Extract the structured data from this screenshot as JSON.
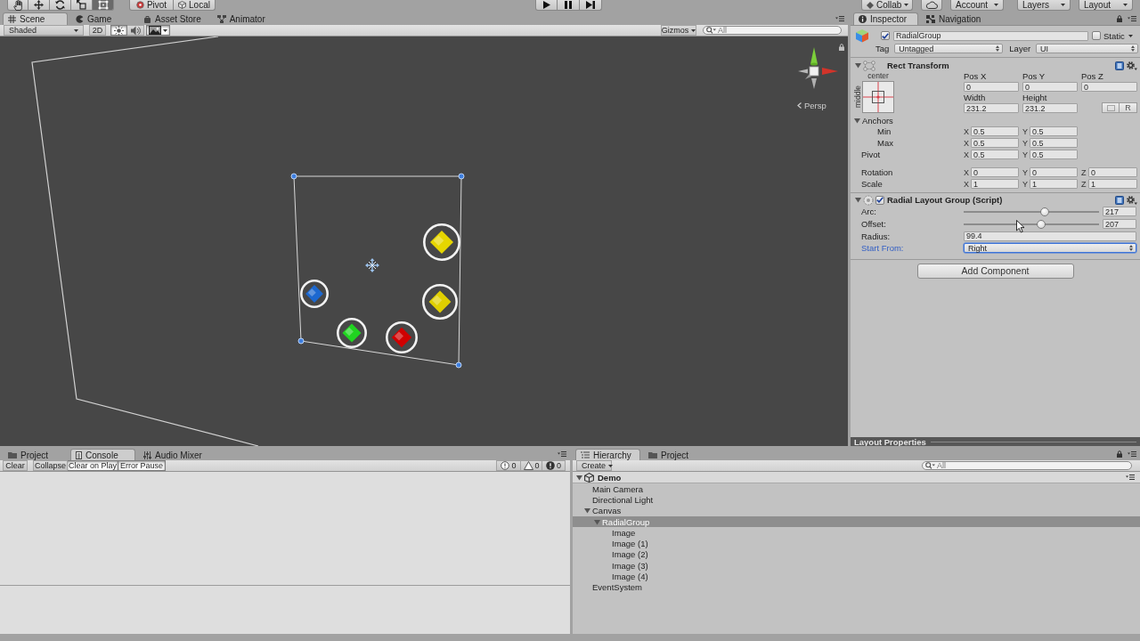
{
  "toolbar": {
    "tools": [
      {
        "kind": "hand",
        "selected": false
      },
      {
        "kind": "move",
        "selected": false
      },
      {
        "kind": "rotate",
        "selected": false
      },
      {
        "kind": "scale",
        "selected": false
      },
      {
        "kind": "rect",
        "selected": true
      }
    ],
    "handle_modes": [
      {
        "kind": "pivot",
        "label": "Pivot"
      },
      {
        "kind": "local",
        "label": "Local"
      }
    ],
    "playback": [
      {
        "kind": "play"
      },
      {
        "kind": "pause"
      },
      {
        "kind": "step"
      }
    ],
    "menus": [
      {
        "kind": "collab",
        "label": "Collab"
      },
      {
        "kind": "cloud"
      },
      {
        "kind": "account",
        "label": "Account"
      },
      {
        "kind": "layers",
        "label": "Layers"
      },
      {
        "kind": "layout",
        "label": "Layout"
      }
    ]
  },
  "scene": {
    "tabs": [
      {
        "kind": "scene",
        "label": "Scene",
        "selected": true
      },
      {
        "kind": "game",
        "label": "Game",
        "selected": false
      },
      {
        "kind": "asset_store",
        "label": "Asset Store",
        "selected": false
      },
      {
        "kind": "animator",
        "label": "Animator",
        "selected": false
      }
    ],
    "toolbar": {
      "draw_mode": "Shaded",
      "toggles": [
        {
          "kind": "flat",
          "label": "2D",
          "on": false
        },
        {
          "kind": "lighting",
          "on": true
        },
        {
          "kind": "audio",
          "on": false
        },
        {
          "kind": "effects",
          "on": true
        }
      ],
      "gizmos": "Gizmos",
      "search": {
        "placeholder": "All"
      }
    },
    "images": [
      {
        "color": "#e6d600"
      },
      {
        "color": "#1c68d0"
      },
      {
        "color": "#e0cf00"
      },
      {
        "color": "#20d420"
      },
      {
        "color": "#d00000"
      }
    ],
    "view_label": "Persp"
  },
  "inspector": {
    "tabs": [
      {
        "kind": "inspector",
        "label": "Inspector",
        "selected": true
      },
      {
        "kind": "navigation",
        "label": "Navigation",
        "selected": false
      }
    ],
    "object": {
      "active": true,
      "name": "RadialGroup",
      "static": false,
      "static_label": "Static",
      "tag_label": "Tag",
      "tag": "Untagged",
      "layer_label": "Layer",
      "layer": "UI"
    },
    "rect_transform": {
      "title": "Rect Transform",
      "expanded": true,
      "anchor_preset": {
        "horizontal": "center",
        "vertical": "middle"
      },
      "position": [
        {
          "label": "Pos X",
          "value": "0"
        },
        {
          "label": "Pos Y",
          "value": "0"
        },
        {
          "label": "Pos Z",
          "value": "0"
        }
      ],
      "size": [
        {
          "label": "Width",
          "value": "231.2"
        },
        {
          "label": "Height",
          "value": "231.2"
        }
      ],
      "raw_edit_label": "R",
      "anchors": {
        "label": "Anchors",
        "expanded": true,
        "rows": [
          {
            "label": "Min",
            "axes": [
              {
                "axis": "X",
                "value": "0.5"
              },
              {
                "axis": "Y",
                "value": "0.5"
              }
            ]
          },
          {
            "label": "Max",
            "axes": [
              {
                "axis": "X",
                "value": "0.5"
              },
              {
                "axis": "Y",
                "value": "0.5"
              }
            ]
          }
        ]
      },
      "rows": [
        {
          "label": "Pivot",
          "axes": [
            {
              "axis": "X",
              "value": "0.5"
            },
            {
              "axis": "Y",
              "value": "0.5"
            }
          ]
        },
        {
          "label": "Rotation",
          "axes": [
            {
              "axis": "X",
              "value": "0"
            },
            {
              "axis": "Y",
              "value": "0"
            },
            {
              "axis": "Z",
              "value": "0"
            }
          ]
        },
        {
          "label": "Scale",
          "axes": [
            {
              "axis": "X",
              "value": "1"
            },
            {
              "axis": "Y",
              "value": "1"
            },
            {
              "axis": "Z",
              "value": "1"
            }
          ]
        }
      ]
    },
    "radial_layout": {
      "title": "Radial Layout Group (Script)",
      "enabled": true,
      "expanded": true,
      "fields": [
        {
          "kind": "slider",
          "label": "Arc:",
          "level": 0.6,
          "value": "217",
          "focused": false
        },
        {
          "kind": "slider",
          "label": "Offset:",
          "level": 0.57,
          "value": "207",
          "focused": false
        },
        {
          "kind": "number",
          "label": "Radius:",
          "value": "99.4",
          "focused": false
        },
        {
          "kind": "dropdown",
          "label": "Start From:",
          "value": "Right",
          "focused": true
        }
      ]
    },
    "add_component": "Add Component",
    "preview_title": "Layout Properties"
  },
  "console": {
    "tabs": [
      {
        "kind": "project",
        "label": "Project",
        "selected": false
      },
      {
        "kind": "console",
        "label": "Console",
        "selected": true
      },
      {
        "kind": "audio_mixer",
        "label": "Audio Mixer",
        "selected": false
      }
    ],
    "buttons": [
      {
        "label": "Clear",
        "on": false
      },
      {
        "label": "Collapse",
        "on": false
      },
      {
        "label": "Clear on Play",
        "on": true
      },
      {
        "label": "Error Pause",
        "on": true
      }
    ],
    "counters": [
      {
        "kind": "info",
        "count": "0"
      },
      {
        "kind": "warning",
        "count": "0"
      },
      {
        "kind": "error",
        "count": "0"
      }
    ]
  },
  "hierarchy": {
    "tabs": [
      {
        "kind": "hierarchy",
        "label": "Hierarchy",
        "selected": true
      },
      {
        "kind": "project",
        "label": "Project",
        "selected": false
      }
    ],
    "create": "Create",
    "search": {
      "placeholder": "All"
    },
    "scene": {
      "name": "Demo",
      "expanded": true,
      "children": [
        {
          "name": "Main Camera",
          "selected": false
        },
        {
          "name": "Directional Light",
          "selected": false
        },
        {
          "name": "Canvas",
          "selected": false,
          "expanded": true,
          "children": [
            {
              "name": "RadialGroup",
              "selected": true,
              "expanded": true,
              "children": [
                {
                  "name": "Image",
                  "selected": false
                },
                {
                  "name": "Image (1)",
                  "selected": false
                },
                {
                  "name": "Image (2)",
                  "selected": false
                },
                {
                  "name": "Image (3)",
                  "selected": false
                },
                {
                  "name": "Image (4)",
                  "selected": false
                }
              ]
            }
          ]
        },
        {
          "name": "EventSystem",
          "selected": false
        }
      ]
    }
  }
}
